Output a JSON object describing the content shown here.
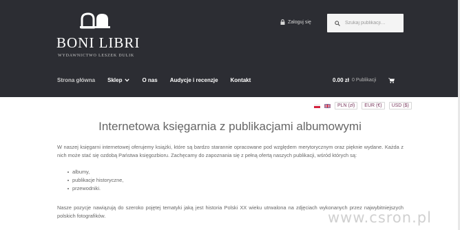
{
  "header": {
    "logo_text": "BONI LIBRI",
    "logo_subtitle": "WYDAWNICTWO LESZEK DULIK",
    "login_label": "Zaloguj się",
    "search_placeholder": "Szukaj publikacji…"
  },
  "nav": {
    "items": [
      {
        "label": "Strona główna"
      },
      {
        "label": "Sklep"
      },
      {
        "label": "O nas"
      },
      {
        "label": "Audycje i recenzje"
      },
      {
        "label": "Kontakt"
      }
    ]
  },
  "cart": {
    "amount": "0.00 zł",
    "count_label": "0 Publikacji"
  },
  "currency": {
    "options": [
      "PLN (zł)",
      "EUR (€)",
      "USD ($)"
    ]
  },
  "content": {
    "title": "Internetowa księgarnia z publikacjami albumowymi",
    "intro": "W naszej księgarni internetowej oferujemy książki, które są bardzo starannie opracowane pod względem merytorycznym oraz pięknie wydane. Każda z nich może stać się ozdobą Państwa księgozbioru. Zachęcamy do zapoznania się z pełną ofertą naszych publikacji, wśród których są:",
    "list": [
      "albumy,",
      "publikacje historyczne,",
      "przewodniki."
    ],
    "outro": "Nasze pozycje nawiązują do szeroko pojętej tematyki jaką jest historia Polski XX wieku utrwalona na zdjęciach wykonanych przez najwybitniejszych polskich fotografików."
  },
  "watermark": "www.csron.pl",
  "colors": {
    "header_bg": "#2c2d33",
    "accent": "#7a3a5f"
  }
}
